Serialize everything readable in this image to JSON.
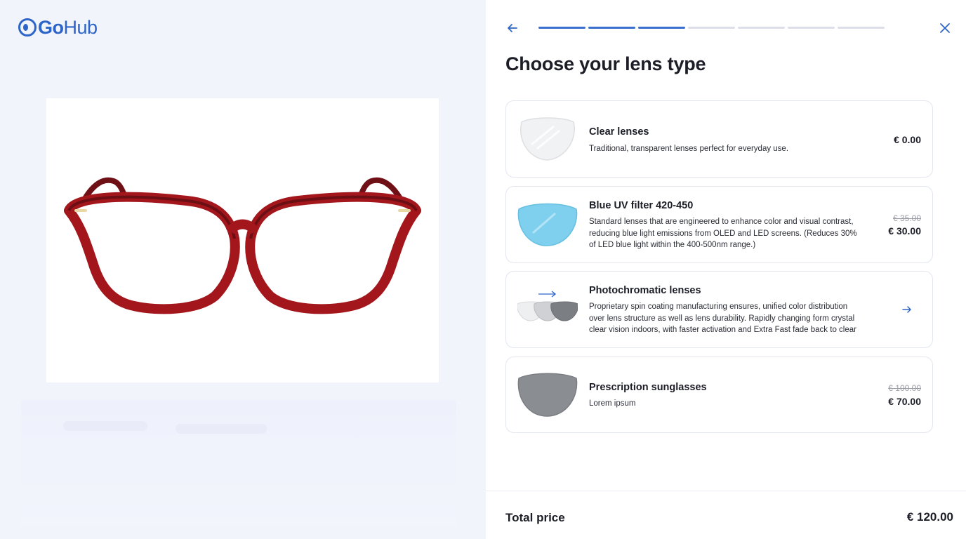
{
  "brand": {
    "name_bold": "Go",
    "name_light": "Hub"
  },
  "header": {
    "title": "Choose your lens type",
    "progress": {
      "total_steps": 7,
      "completed_steps": 3
    }
  },
  "lens_options": [
    {
      "name": "Clear lenses",
      "description": "Traditional, transparent lenses perfect for everyday use.",
      "price": "€ 0.00",
      "old_price": "",
      "icon": "clear-lens-icon"
    },
    {
      "name": "Blue UV filter 420-450",
      "description": "Standard lenses that are engineered to enhance color and visual contrast, reducing blue light emissions from OLED and LED screens. (Reduces 30% of LED blue light within the 400-500nm range.)",
      "price": "€ 30.00",
      "old_price": "€ 35.00",
      "icon": "blue-lens-icon"
    },
    {
      "name": "Photochromatic lenses",
      "description": "Proprietary spin coating manufacturing ensures, unified color distribution over lens structure as well as lens durability. Rapidly changing form crystal clear vision indoors, with faster activation and Extra Fast fade back to clear",
      "price": "",
      "old_price": "",
      "icon": "photochromatic-lens-icon"
    },
    {
      "name": "Prescription sunglasses",
      "description": "Lorem ipsum",
      "price": "€ 70.00",
      "old_price": "€ 100.00",
      "icon": "sunglass-lens-icon"
    }
  ],
  "footer": {
    "label": "Total price",
    "value": "€ 120.00"
  },
  "colors": {
    "accent": "#2d64c8",
    "frame": "#a3161c",
    "blue_lens": "#7fd0ee"
  }
}
